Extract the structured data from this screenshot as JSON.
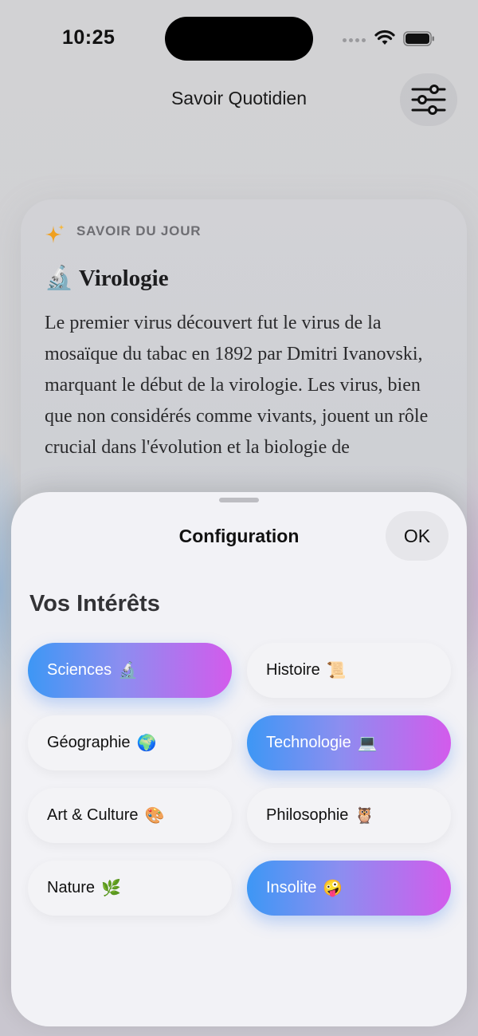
{
  "status_bar": {
    "time": "10:25"
  },
  "nav": {
    "title": "Savoir Quotidien",
    "filter_icon": "sliders-icon"
  },
  "card": {
    "kicker": "SAVOIR DU JOUR",
    "kicker_icon": "sparkles-icon",
    "title": "🔬 Virologie",
    "body": "Le premier virus découvert fut le virus de la mosaïque du tabac en 1892 par Dmitri Ivanovski, marquant le début de la virologie. Les virus, bien que non considérés comme vivants, jouent un rôle crucial dans l'évolution et la biologie de"
  },
  "sheet": {
    "title": "Configuration",
    "done_label": "OK",
    "section_title": "Vos Intérêts",
    "chips": [
      {
        "label": "Sciences",
        "emoji": "🔬",
        "selected": true
      },
      {
        "label": "Histoire",
        "emoji": "📜",
        "selected": false
      },
      {
        "label": "Géographie",
        "emoji": "🌍",
        "selected": false
      },
      {
        "label": "Technologie",
        "emoji": "💻",
        "selected": true
      },
      {
        "label": "Art & Culture",
        "emoji": "🎨",
        "selected": false
      },
      {
        "label": "Philosophie",
        "emoji": "🦉",
        "selected": false
      },
      {
        "label": "Nature",
        "emoji": "🌿",
        "selected": false
      },
      {
        "label": "Insolite",
        "emoji": "🤪",
        "selected": true
      }
    ]
  },
  "colors": {
    "chip_gradient_start": "#3d97f5",
    "chip_gradient_end": "#d35bec",
    "sparkle": "#f0a020"
  }
}
